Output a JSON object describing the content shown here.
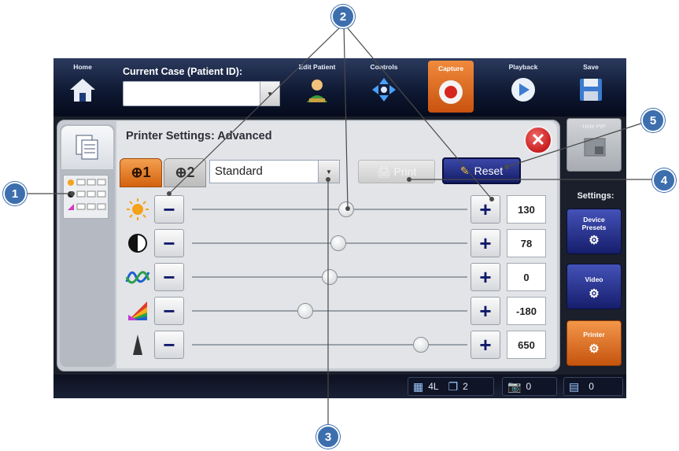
{
  "nav": {
    "home": "Home",
    "case_label": "Current Case (Patient ID):",
    "case_value": "",
    "edit_patient": "Edit Patient",
    "controls": "Controls",
    "capture": "Capture",
    "playback": "Playback",
    "save": "Save"
  },
  "panel": {
    "title": "Printer Settings: Advanced",
    "tab1": "1",
    "tab2": "2",
    "preset": "Standard",
    "print_label": "Print",
    "reset_label": "Reset"
  },
  "sliders": [
    {
      "icon": "brightness-icon",
      "value": "130",
      "fraction": 0.56
    },
    {
      "icon": "contrast-icon",
      "value": "78",
      "fraction": 0.53
    },
    {
      "icon": "wave-icon",
      "value": "0",
      "fraction": 0.5
    },
    {
      "icon": "color-icon",
      "value": "-180",
      "fraction": 0.41
    },
    {
      "icon": "sharpness-icon",
      "value": "650",
      "fraction": 0.83
    }
  ],
  "right": {
    "hide_pip": "Hide PIP",
    "settings": "Settings:",
    "device_presets_1": "Device",
    "device_presets_2": "Presets",
    "video": "Video",
    "printer": "Printer"
  },
  "status": {
    "layout": "4L",
    "copies": "2",
    "photos": "0",
    "videos": "0"
  },
  "callouts": [
    "1",
    "2",
    "3",
    "4",
    "5"
  ],
  "colors": {
    "accent_orange": "#e0701e",
    "nav_blue": "#141c66",
    "callout": "#3d6fae"
  }
}
